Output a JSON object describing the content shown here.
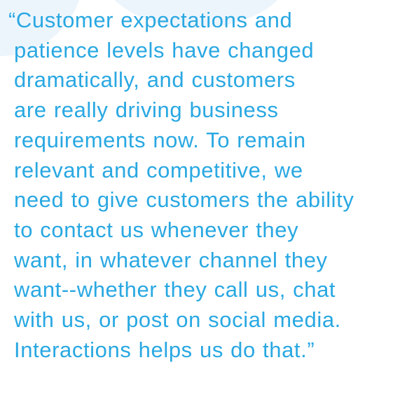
{
  "colors": {
    "text": "#29a8e2",
    "circle": "#edf5fc",
    "background": "#ffffff"
  },
  "quote": {
    "lines": [
      "“Customer expectations and",
      "patience levels have changed",
      "dramatically, and customers",
      "are really driving business",
      "requirements now. To remain",
      "relevant and competitive, we",
      "need to give customers the ability",
      "to contact us whenever they",
      "want, in whatever channel they",
      "want--whether they call us, chat",
      "with us, or post on social media.",
      "Interactions helps us do that.”"
    ]
  }
}
